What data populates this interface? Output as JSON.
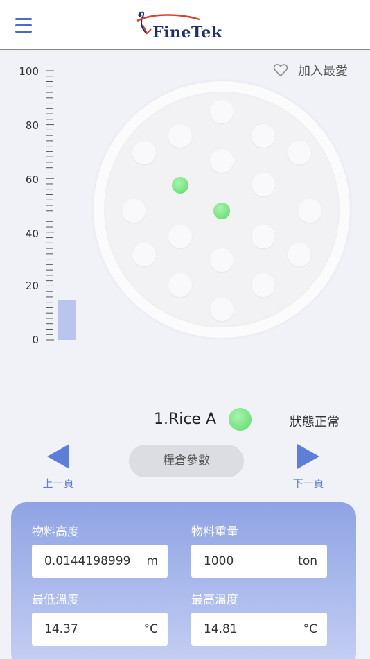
{
  "header": {
    "logo_text": "FineTek",
    "menu_icon": "hamburger-icon",
    "colors": {
      "accent": "#4a6cc6",
      "logo_text": "#1f2f6e",
      "logo_mark": "#d6402f"
    }
  },
  "favorite": {
    "label": "加入最愛",
    "icon": "heart-outline-icon"
  },
  "gauge": {
    "tick_labels": [
      "100",
      "80",
      "60",
      "40",
      "20",
      "0"
    ],
    "max": 100,
    "min": 0,
    "level_percent": 15,
    "bar_color": "#b9c5ec"
  },
  "silo": {
    "sensor_count": 18,
    "active_sensors": 2,
    "active_color": "#5fd86a"
  },
  "status": {
    "silo_name": "1.Rice A",
    "status_text": "狀態正常",
    "status_color": "#5fd86a"
  },
  "navigation": {
    "prev_label": "上一頁",
    "next_label": "下一頁",
    "param_button": "糧倉參數",
    "arrow_color": "#5e7fd8"
  },
  "params": {
    "material_height": {
      "label": "物料高度",
      "value": "0.0144198999",
      "unit": "m"
    },
    "material_weight": {
      "label": "物料重量",
      "value": "1000",
      "unit": "ton"
    },
    "min_temp": {
      "label": "最低溫度",
      "value": "14.37",
      "unit": "°C"
    },
    "max_temp": {
      "label": "最高溫度",
      "value": "14.81",
      "unit": "°C"
    }
  }
}
